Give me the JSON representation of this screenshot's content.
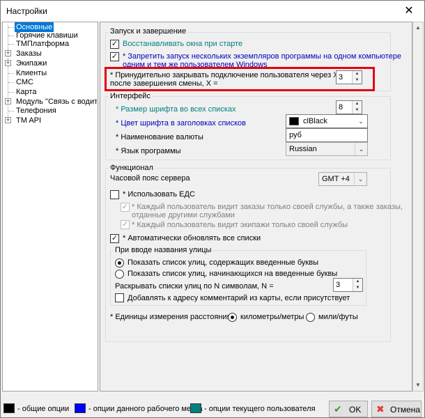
{
  "window": {
    "title": "Настройки",
    "close_glyph": "✕"
  },
  "tree": {
    "items": [
      {
        "label": "Основные",
        "selected": true
      },
      {
        "label": "Горячие клавиши"
      },
      {
        "label": "ТМПлатформа"
      },
      {
        "label": "Заказы",
        "expandable": true
      },
      {
        "label": "Экипажи",
        "expandable": true
      },
      {
        "label": "Клиенты"
      },
      {
        "label": "СМС"
      },
      {
        "label": "Карта"
      },
      {
        "label": "Модуль \"Связь с водителем\"",
        "expandable": true
      },
      {
        "label": "Телефония"
      },
      {
        "label": "TM API",
        "expandable": true
      }
    ]
  },
  "startup": {
    "title": "Запуск и завершение",
    "restore_windows": {
      "label": "Восстанавливать окна при старте",
      "checked": true
    },
    "single_instance": {
      "label": "* Запретить запуск нескольких экземпляров программы на одном компьютере одним и тем же пользователем Windows",
      "line1": "* Запретить запуск нескольких экземпляров программы на одном компьютере",
      "line2": "одним и тем же пользователем Windows",
      "checked": true
    },
    "force_close": {
      "line1": "* Принудительно закрывать подключение пользователя через X мин",
      "line2": "после завершения смены, X =",
      "value": "3"
    }
  },
  "interface": {
    "title": "Интерфейс",
    "font_size": {
      "label": "* Размер шрифта во всех списках",
      "value": "8"
    },
    "header_color": {
      "label": "* Цвет шрифта в заголовках списков",
      "value": "clBlack",
      "swatch": "#000000"
    },
    "currency": {
      "label": "* Наименование валюты",
      "value": "руб"
    },
    "language": {
      "label": "* Язык программы",
      "value": "Russian"
    }
  },
  "functional": {
    "title": "Функционал",
    "timezone": {
      "label": "Часовой пояс сервера",
      "value": "GMT +4"
    },
    "use_eds": {
      "label": "* Использовать ЕДС",
      "checked": false
    },
    "each_user_orders": {
      "line1": "* Каждый пользователь видит заказы только своей службы, а также заказы,",
      "line2": "отданные другими службами",
      "checked": true
    },
    "each_user_crews": {
      "label": "* Каждый пользователь видит экипажи только своей службы",
      "checked": true
    },
    "auto_refresh": {
      "label": "* Автоматически обновлять все списки",
      "checked": true
    },
    "street": {
      "title": "При вводе названия улицы",
      "opt_contains": {
        "label": "Показать список улиц, содержащих введенные буквы",
        "selected": true
      },
      "opt_starts": {
        "label": "Показать список улиц, начинающихся на введенные буквы",
        "selected": false
      },
      "expand_n": {
        "label": "Раскрывать списки улиц по N символам, N =",
        "value": "3"
      },
      "add_comment": {
        "label": "Добавлять к адресу комментарий из карты, если присутствует",
        "checked": false
      }
    },
    "units": {
      "label": "* Единицы измерения расстояния:",
      "km": "километры/метры",
      "miles": "мили/футы",
      "selected": "km"
    }
  },
  "footer": {
    "legend": [
      {
        "label": "- общие опции",
        "color": "#000000"
      },
      {
        "label": "- опции данного рабочего места",
        "color": "#0000ff"
      },
      {
        "label": "- опции текущего пользователя",
        "color": "#008080"
      }
    ],
    "ok_label": "OK",
    "cancel_label": "Отмена"
  }
}
